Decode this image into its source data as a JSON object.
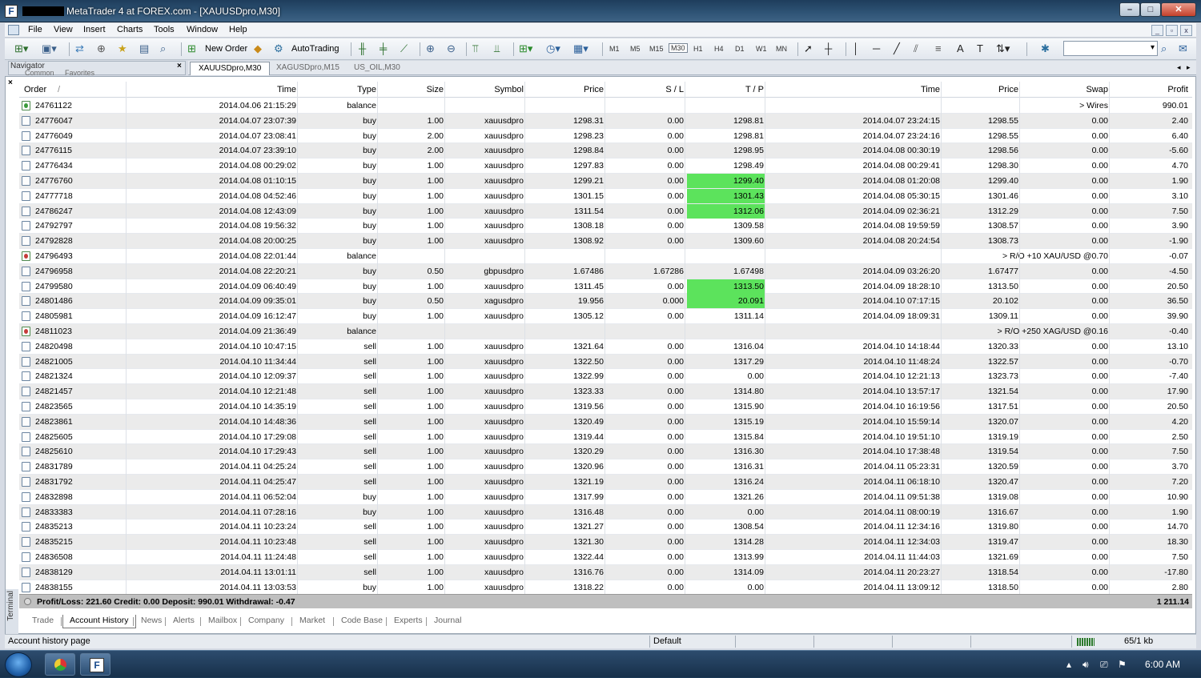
{
  "window": {
    "title": "MetaTrader 4 at FOREX.com - [XAUUSDpro,M30]",
    "controls": [
      "–",
      "□",
      "✕"
    ]
  },
  "menu": [
    "File",
    "View",
    "Insert",
    "Charts",
    "Tools",
    "Window",
    "Help"
  ],
  "toolbar": {
    "new_order": "New Order",
    "autotrading": "AutoTrading",
    "timeframes": [
      "M1",
      "M5",
      "M15",
      "M30",
      "H1",
      "H4",
      "D1",
      "W1",
      "MN"
    ],
    "active_timeframe": "M30"
  },
  "navigator": {
    "title": "Navigator",
    "tabs": [
      "Common",
      "Favorites"
    ]
  },
  "chart_tabs": [
    "XAUUSDpro,M30",
    "XAGUSDpro,M15",
    "US_OIL,M30"
  ],
  "terminal": {
    "side_label": "Terminal",
    "columns": [
      "Order",
      "/",
      "Time",
      "Type",
      "Size",
      "Symbol",
      "Price",
      "S / L",
      "T / P",
      "Time",
      "Price",
      "Swap",
      "Profit"
    ],
    "rows": [
      {
        "order": "24761122",
        "time": "2014.04.06 21:15:29",
        "type": "balance",
        "size": "",
        "symbol": "",
        "price": "",
        "sl": "",
        "tp": "",
        "ctime": "",
        "cprice": "",
        "swap": "",
        "comment": "> Wires",
        "profit": "990.01"
      },
      {
        "order": "24776047",
        "time": "2014.04.07 23:07:39",
        "type": "buy",
        "size": "1.00",
        "symbol": "xauusdpro",
        "price": "1298.31",
        "sl": "0.00",
        "tp": "1298.81",
        "ctime": "2014.04.07 23:24:15",
        "cprice": "1298.55",
        "swap": "0.00",
        "comment": "",
        "profit": "2.40"
      },
      {
        "order": "24776049",
        "time": "2014.04.07 23:08:41",
        "type": "buy",
        "size": "2.00",
        "symbol": "xauusdpro",
        "price": "1298.23",
        "sl": "0.00",
        "tp": "1298.81",
        "ctime": "2014.04.07 23:24:16",
        "cprice": "1298.55",
        "swap": "0.00",
        "comment": "",
        "profit": "6.40"
      },
      {
        "order": "24776115",
        "time": "2014.04.07 23:39:10",
        "type": "buy",
        "size": "2.00",
        "symbol": "xauusdpro",
        "price": "1298.84",
        "sl": "0.00",
        "tp": "1298.95",
        "ctime": "2014.04.08 00:30:19",
        "cprice": "1298.56",
        "swap": "0.00",
        "comment": "",
        "profit": "-5.60"
      },
      {
        "order": "24776434",
        "time": "2014.04.08 00:29:02",
        "type": "buy",
        "size": "1.00",
        "symbol": "xauusdpro",
        "price": "1297.83",
        "sl": "0.00",
        "tp": "1298.49",
        "ctime": "2014.04.08 00:29:41",
        "cprice": "1298.30",
        "swap": "0.00",
        "comment": "",
        "profit": "4.70"
      },
      {
        "order": "24776760",
        "time": "2014.04.08 01:10:15",
        "type": "buy",
        "size": "1.00",
        "symbol": "xauusdpro",
        "price": "1299.21",
        "sl": "0.00",
        "tp": "1299.40",
        "ctime": "2014.04.08 01:20:08",
        "cprice": "1299.40",
        "swap": "0.00",
        "comment": "",
        "profit": "1.90",
        "tp_hit": true
      },
      {
        "order": "24777718",
        "time": "2014.04.08 04:52:46",
        "type": "buy",
        "size": "1.00",
        "symbol": "xauusdpro",
        "price": "1301.15",
        "sl": "0.00",
        "tp": "1301.43",
        "ctime": "2014.04.08 05:30:15",
        "cprice": "1301.46",
        "swap": "0.00",
        "comment": "",
        "profit": "3.10",
        "tp_hit": true
      },
      {
        "order": "24786247",
        "time": "2014.04.08 12:43:09",
        "type": "buy",
        "size": "1.00",
        "symbol": "xauusdpro",
        "price": "1311.54",
        "sl": "0.00",
        "tp": "1312.06",
        "ctime": "2014.04.09 02:36:21",
        "cprice": "1312.29",
        "swap": "0.00",
        "comment": "",
        "profit": "7.50",
        "tp_hit": true
      },
      {
        "order": "24792797",
        "time": "2014.04.08 19:56:32",
        "type": "buy",
        "size": "1.00",
        "symbol": "xauusdpro",
        "price": "1308.18",
        "sl": "0.00",
        "tp": "1309.58",
        "ctime": "2014.04.08 19:59:59",
        "cprice": "1308.57",
        "swap": "0.00",
        "comment": "",
        "profit": "3.90"
      },
      {
        "order": "24792828",
        "time": "2014.04.08 20:00:25",
        "type": "buy",
        "size": "1.00",
        "symbol": "xauusdpro",
        "price": "1308.92",
        "sl": "0.00",
        "tp": "1309.60",
        "ctime": "2014.04.08 20:24:54",
        "cprice": "1308.73",
        "swap": "0.00",
        "comment": "",
        "profit": "-1.90"
      },
      {
        "order": "24796493",
        "time": "2014.04.08 22:01:44",
        "type": "balance",
        "size": "",
        "symbol": "",
        "price": "",
        "sl": "",
        "tp": "",
        "ctime": "",
        "cprice": "",
        "swap": "",
        "comment": "> R/O +10 XAU/USD @0.70",
        "profit": "-0.07",
        "neg": true
      },
      {
        "order": "24796958",
        "time": "2014.04.08 22:20:21",
        "type": "buy",
        "size": "0.50",
        "symbol": "gbpusdpro",
        "price": "1.67486",
        "sl": "1.67286",
        "tp": "1.67498",
        "ctime": "2014.04.09 03:26:20",
        "cprice": "1.67477",
        "swap": "0.00",
        "comment": "",
        "profit": "-4.50"
      },
      {
        "order": "24799580",
        "time": "2014.04.09 06:40:49",
        "type": "buy",
        "size": "1.00",
        "symbol": "xauusdpro",
        "price": "1311.45",
        "sl": "0.00",
        "tp": "1313.50",
        "ctime": "2014.04.09 18:28:10",
        "cprice": "1313.50",
        "swap": "0.00",
        "comment": "",
        "profit": "20.50",
        "tp_hit": true
      },
      {
        "order": "24801486",
        "time": "2014.04.09 09:35:01",
        "type": "buy",
        "size": "0.50",
        "symbol": "xagusdpro",
        "price": "19.956",
        "sl": "0.000",
        "tp": "20.091",
        "ctime": "2014.04.10 07:17:15",
        "cprice": "20.102",
        "swap": "0.00",
        "comment": "",
        "profit": "36.50",
        "tp_hit": true
      },
      {
        "order": "24805981",
        "time": "2014.04.09 16:12:47",
        "type": "buy",
        "size": "1.00",
        "symbol": "xauusdpro",
        "price": "1305.12",
        "sl": "0.00",
        "tp": "1311.14",
        "ctime": "2014.04.09 18:09:31",
        "cprice": "1309.11",
        "swap": "0.00",
        "comment": "",
        "profit": "39.90"
      },
      {
        "order": "24811023",
        "time": "2014.04.09 21:36:49",
        "type": "balance",
        "size": "",
        "symbol": "",
        "price": "",
        "sl": "",
        "tp": "",
        "ctime": "",
        "cprice": "",
        "swap": "",
        "comment": "> R/O +250 XAG/USD @0.16",
        "profit": "-0.40",
        "neg": true
      },
      {
        "order": "24820498",
        "time": "2014.04.10 10:47:15",
        "type": "sell",
        "size": "1.00",
        "symbol": "xauusdpro",
        "price": "1321.64",
        "sl": "0.00",
        "tp": "1316.04",
        "ctime": "2014.04.10 14:18:44",
        "cprice": "1320.33",
        "swap": "0.00",
        "comment": "",
        "profit": "13.10"
      },
      {
        "order": "24821005",
        "time": "2014.04.10 11:34:44",
        "type": "sell",
        "size": "1.00",
        "symbol": "xauusdpro",
        "price": "1322.50",
        "sl": "0.00",
        "tp": "1317.29",
        "ctime": "2014.04.10 11:48:24",
        "cprice": "1322.57",
        "swap": "0.00",
        "comment": "",
        "profit": "-0.70"
      },
      {
        "order": "24821324",
        "time": "2014.04.10 12:09:37",
        "type": "sell",
        "size": "1.00",
        "symbol": "xauusdpro",
        "price": "1322.99",
        "sl": "0.00",
        "tp": "0.00",
        "ctime": "2014.04.10 12:21:13",
        "cprice": "1323.73",
        "swap": "0.00",
        "comment": "",
        "profit": "-7.40"
      },
      {
        "order": "24821457",
        "time": "2014.04.10 12:21:48",
        "type": "sell",
        "size": "1.00",
        "symbol": "xauusdpro",
        "price": "1323.33",
        "sl": "0.00",
        "tp": "1314.80",
        "ctime": "2014.04.10 13:57:17",
        "cprice": "1321.54",
        "swap": "0.00",
        "comment": "",
        "profit": "17.90"
      },
      {
        "order": "24823565",
        "time": "2014.04.10 14:35:19",
        "type": "sell",
        "size": "1.00",
        "symbol": "xauusdpro",
        "price": "1319.56",
        "sl": "0.00",
        "tp": "1315.90",
        "ctime": "2014.04.10 16:19:56",
        "cprice": "1317.51",
        "swap": "0.00",
        "comment": "",
        "profit": "20.50"
      },
      {
        "order": "24823861",
        "time": "2014.04.10 14:48:36",
        "type": "sell",
        "size": "1.00",
        "symbol": "xauusdpro",
        "price": "1320.49",
        "sl": "0.00",
        "tp": "1315.19",
        "ctime": "2014.04.10 15:59:14",
        "cprice": "1320.07",
        "swap": "0.00",
        "comment": "",
        "profit": "4.20"
      },
      {
        "order": "24825605",
        "time": "2014.04.10 17:29:08",
        "type": "sell",
        "size": "1.00",
        "symbol": "xauusdpro",
        "price": "1319.44",
        "sl": "0.00",
        "tp": "1315.84",
        "ctime": "2014.04.10 19:51:10",
        "cprice": "1319.19",
        "swap": "0.00",
        "comment": "",
        "profit": "2.50"
      },
      {
        "order": "24825610",
        "time": "2014.04.10 17:29:43",
        "type": "sell",
        "size": "1.00",
        "symbol": "xauusdpro",
        "price": "1320.29",
        "sl": "0.00",
        "tp": "1316.30",
        "ctime": "2014.04.10 17:38:48",
        "cprice": "1319.54",
        "swap": "0.00",
        "comment": "",
        "profit": "7.50"
      },
      {
        "order": "24831789",
        "time": "2014.04.11 04:25:24",
        "type": "sell",
        "size": "1.00",
        "symbol": "xauusdpro",
        "price": "1320.96",
        "sl": "0.00",
        "tp": "1316.31",
        "ctime": "2014.04.11 05:23:31",
        "cprice": "1320.59",
        "swap": "0.00",
        "comment": "",
        "profit": "3.70"
      },
      {
        "order": "24831792",
        "time": "2014.04.11 04:25:47",
        "type": "sell",
        "size": "1.00",
        "symbol": "xauusdpro",
        "price": "1321.19",
        "sl": "0.00",
        "tp": "1316.24",
        "ctime": "2014.04.11 06:18:10",
        "cprice": "1320.47",
        "swap": "0.00",
        "comment": "",
        "profit": "7.20"
      },
      {
        "order": "24832898",
        "time": "2014.04.11 06:52:04",
        "type": "buy",
        "size": "1.00",
        "symbol": "xauusdpro",
        "price": "1317.99",
        "sl": "0.00",
        "tp": "1321.26",
        "ctime": "2014.04.11 09:51:38",
        "cprice": "1319.08",
        "swap": "0.00",
        "comment": "",
        "profit": "10.90"
      },
      {
        "order": "24833383",
        "time": "2014.04.11 07:28:16",
        "type": "buy",
        "size": "1.00",
        "symbol": "xauusdpro",
        "price": "1316.48",
        "sl": "0.00",
        "tp": "0.00",
        "ctime": "2014.04.11 08:00:19",
        "cprice": "1316.67",
        "swap": "0.00",
        "comment": "",
        "profit": "1.90"
      },
      {
        "order": "24835213",
        "time": "2014.04.11 10:23:24",
        "type": "sell",
        "size": "1.00",
        "symbol": "xauusdpro",
        "price": "1321.27",
        "sl": "0.00",
        "tp": "1308.54",
        "ctime": "2014.04.11 12:34:16",
        "cprice": "1319.80",
        "swap": "0.00",
        "comment": "",
        "profit": "14.70"
      },
      {
        "order": "24835215",
        "time": "2014.04.11 10:23:48",
        "type": "sell",
        "size": "1.00",
        "symbol": "xauusdpro",
        "price": "1321.30",
        "sl": "0.00",
        "tp": "1314.28",
        "ctime": "2014.04.11 12:34:03",
        "cprice": "1319.47",
        "swap": "0.00",
        "comment": "",
        "profit": "18.30"
      },
      {
        "order": "24836508",
        "time": "2014.04.11 11:24:48",
        "type": "sell",
        "size": "1.00",
        "symbol": "xauusdpro",
        "price": "1322.44",
        "sl": "0.00",
        "tp": "1313.99",
        "ctime": "2014.04.11 11:44:03",
        "cprice": "1321.69",
        "swap": "0.00",
        "comment": "",
        "profit": "7.50"
      },
      {
        "order": "24838129",
        "time": "2014.04.11 13:01:11",
        "type": "sell",
        "size": "1.00",
        "symbol": "xauusdpro",
        "price": "1316.76",
        "sl": "0.00",
        "tp": "1314.09",
        "ctime": "2014.04.11 20:23:27",
        "cprice": "1318.54",
        "swap": "0.00",
        "comment": "",
        "profit": "-17.80"
      },
      {
        "order": "24838155",
        "time": "2014.04.11 13:03:53",
        "type": "buy",
        "size": "1.00",
        "symbol": "xauusdpro",
        "price": "1318.22",
        "sl": "0.00",
        "tp": "0.00",
        "ctime": "2014.04.11 13:09:12",
        "cprice": "1318.50",
        "swap": "0.00",
        "comment": "",
        "profit": "2.80"
      }
    ],
    "summary": {
      "text": "Profit/Loss: 221.60  Credit: 0.00  Deposit: 990.01  Withdrawal: -0.47",
      "total": "1 211.14"
    },
    "tabs": [
      "Trade",
      "Account History",
      "News",
      "Alerts",
      "Mailbox",
      "Company",
      "Market",
      "Code Base",
      "Experts",
      "Journal"
    ],
    "active_tab": "Account History"
  },
  "status_bar": {
    "left": "Account history page",
    "profile": "Default",
    "traffic": "65/1 kb"
  },
  "taskbar": {
    "clock": "6:00 AM"
  },
  "colors": {
    "tp_highlight": "#5ce35c",
    "alt_row": "#ebebeb",
    "summary_bg": "#bfbfbf"
  }
}
